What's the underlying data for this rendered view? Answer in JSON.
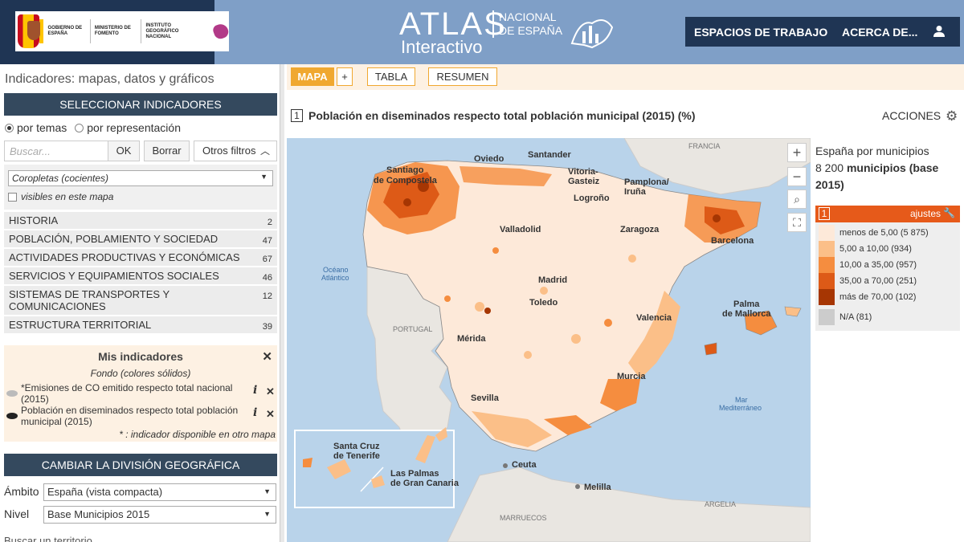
{
  "header": {
    "gov_labels": [
      "Gobierno de España",
      "Ministerio de Fomento",
      "Instituto Geográfico Nacional"
    ],
    "atlas_title": "ATLAS",
    "atlas_subtitle": "Interactivo",
    "atlas_national": "NACIONAL DE ESPAÑA",
    "nav_workspaces": "ESPACIOS DE TRABAJO",
    "nav_about": "ACERCA DE...",
    "user_icon": "user-icon"
  },
  "left": {
    "panel_title": "Indicadores: mapas, datos y gráficos",
    "select_indicators": "SELECCIONAR INDICADORES",
    "radio_themes": "por temas",
    "radio_representation": "por representación",
    "search_placeholder": "Buscar...",
    "ok": "OK",
    "clear": "Borrar",
    "other_filters": "Otros filtros",
    "representation_select": "Coropletas (cocientes)",
    "visible_check": "visibles en este mapa",
    "categories": [
      {
        "label": "HISTORIA",
        "count": "2"
      },
      {
        "label": "POBLACIÓN, POBLAMIENTO Y SOCIEDAD",
        "count": "47"
      },
      {
        "label": "ACTIVIDADES PRODUCTIVAS Y ECONÓMICAS",
        "count": "67"
      },
      {
        "label": "SERVICIOS Y EQUIPAMIENTOS SOCIALES",
        "count": "46"
      },
      {
        "label": "SISTEMAS DE TRANSPORTES Y COMUNICACIONES",
        "count": "12"
      },
      {
        "label": "ESTRUCTURA TERRITORIAL",
        "count": "39"
      }
    ],
    "my_indicators": {
      "title": "Mis indicadores",
      "background": "Fondo (colores sólidos)",
      "items": [
        "*Emisiones de CO emitido respecto total nacional (2015)",
        "Población en diseminados respecto total población municipal (2015)"
      ],
      "note": "* : indicador disponible en otro mapa"
    },
    "change_division": "CAMBIAR LA DIVISIÓN GEOGRÁFICA",
    "scope_label": "Ámbito",
    "scope_value": "España (vista compacta)",
    "level_label": "Nivel",
    "level_value": "Base Municipios 2015",
    "search_territory": "Buscar un territorio"
  },
  "tabs": {
    "map": "MAPA",
    "plus": "+",
    "table": "TABLA",
    "summary": "RESUMEN"
  },
  "map": {
    "number": "1",
    "title": "Población en diseminados respecto total población municipal (2015) (%)",
    "actions": "ACCIONES",
    "zoom_in": "+",
    "zoom_out": "−",
    "places": {
      "francia": "FRANCIA",
      "santander": "Santander",
      "oviedo": "Oviedo",
      "santiago1": "Santiago",
      "santiago2": "de Compostela",
      "vitoria1": "Vitoria-",
      "vitoria2": "Gasteiz",
      "pamplona1": "Pamplona/",
      "pamplona2": "Iruña",
      "logrono": "Logroño",
      "valladolid": "Valladolid",
      "zaragoza": "Zaragoza",
      "barcelona": "Barcelona",
      "oceano1": "Océano",
      "oceano2": "Atlántico",
      "madrid": "Madrid",
      "toledo": "Toledo",
      "palma1": "Palma",
      "palma2": "de Mallorca",
      "portugal": "PORTUGAL",
      "valencia": "Valencia",
      "merida": "Mérida",
      "mar1": "Mar",
      "mar2": "Mediterráneo",
      "murcia": "Murcia",
      "sevilla": "Sevilla",
      "tenerife1": "Santa Cruz",
      "tenerife2": "de Tenerife",
      "laspalmas1": "Las Palmas",
      "laspalmas2": "de Gran Canaria",
      "ceuta": "Ceuta",
      "melilla": "Melilla",
      "marruecos": "MARRUECOS",
      "argelia": "ARGELIA"
    }
  },
  "legend": {
    "scope": "España por municipios",
    "count_prefix": "8 200",
    "count_bold": "municipios (base 2015)",
    "number": "1",
    "settings": "ajustes",
    "classes": [
      {
        "label": "menos de 5,00 (5 875)",
        "color": "#fde9d9"
      },
      {
        "label": "5,00 a 10,00 (934)",
        "color": "#fbbf88"
      },
      {
        "label": "10,00 a 35,00 (957)",
        "color": "#f58d3f"
      },
      {
        "label": "35,00 a 70,00 (251)",
        "color": "#dd5a17"
      },
      {
        "label": "más de 70,00 (102)",
        "color": "#a63603"
      },
      {
        "label": "N/A (81)",
        "color": "#cccccc"
      }
    ]
  }
}
